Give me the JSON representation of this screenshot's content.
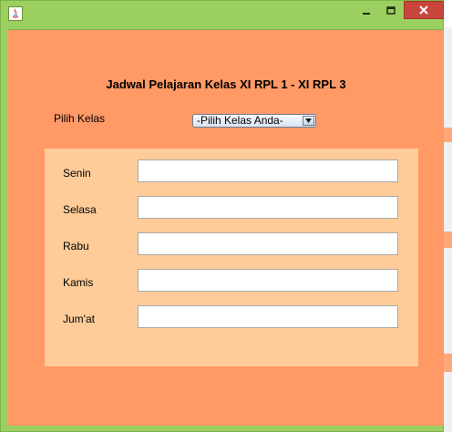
{
  "window": {
    "title": "",
    "controls": {
      "minimize": "minimize-icon",
      "maximize": "maximize-icon",
      "close": "close-icon"
    }
  },
  "form": {
    "heading": "Jadwal Pelajaran Kelas XI RPL 1 - XI RPL 3",
    "class_label": "Pilih Kelas",
    "class_select": {
      "selected": "-Pilih Kelas Anda-"
    },
    "schedule": [
      {
        "day": "Senin",
        "value": ""
      },
      {
        "day": "Selasa",
        "value": ""
      },
      {
        "day": "Rabu",
        "value": ""
      },
      {
        "day": "Kamis",
        "value": ""
      },
      {
        "day": "Jum'at",
        "value": ""
      }
    ]
  },
  "colors": {
    "window_frame": "#9bd060",
    "content_bg": "#ff9966",
    "panel_bg": "#ffcc99",
    "close_button": "#c7453b"
  }
}
